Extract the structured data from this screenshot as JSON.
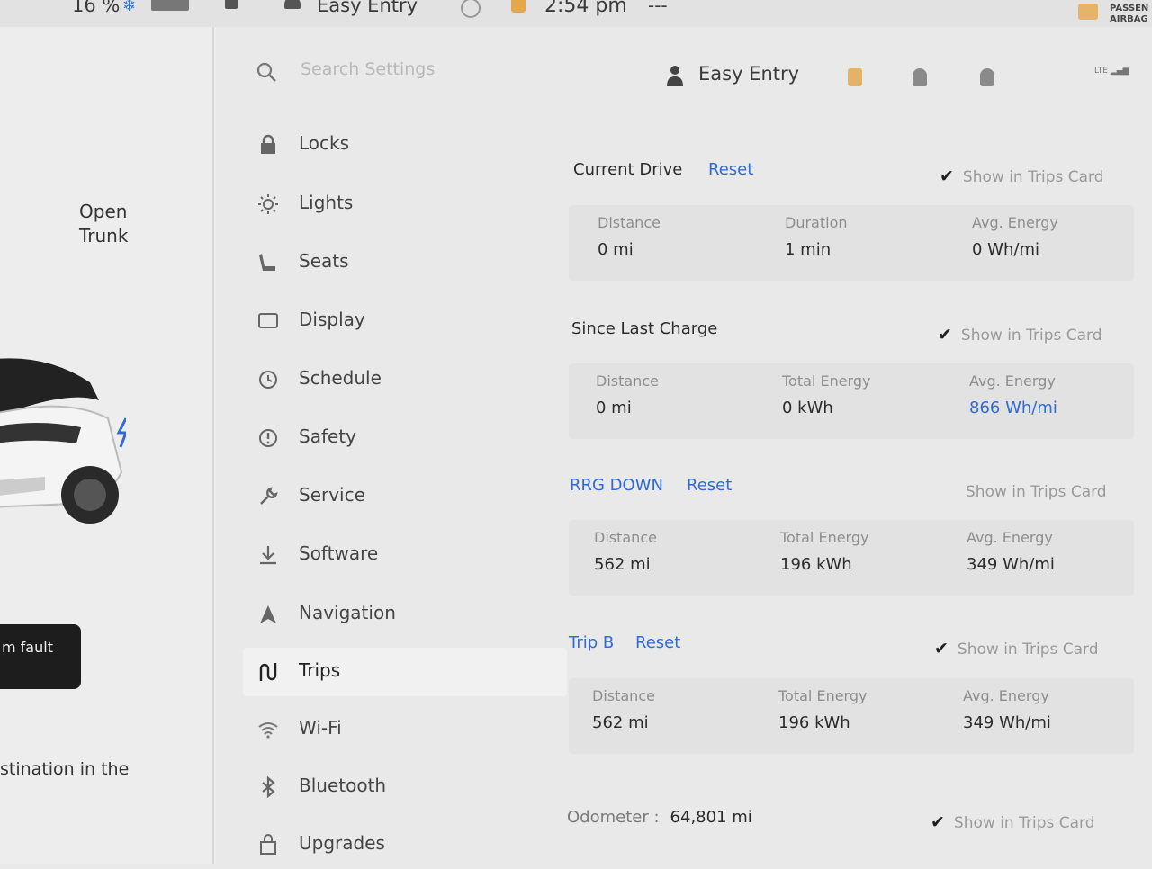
{
  "status_bar": {
    "battery": "16 %",
    "profile": "Easy Entry",
    "time": "2:54 pm",
    "temp": "---",
    "airbag_line1": "PASSEN",
    "airbag_line2": "AIRBAG"
  },
  "car_panel": {
    "open_trunk_line1": "Open",
    "open_trunk_line2": "Trunk",
    "fault_text": "m fault",
    "destination_text": "stination in the"
  },
  "search": {
    "placeholder": "Search Settings"
  },
  "sidebar": {
    "items": [
      {
        "label": "Locks",
        "icon": "lock-icon"
      },
      {
        "label": "Lights",
        "icon": "lightbulb-icon"
      },
      {
        "label": "Seats",
        "icon": "seat-icon"
      },
      {
        "label": "Display",
        "icon": "display-icon"
      },
      {
        "label": "Schedule",
        "icon": "clock-icon"
      },
      {
        "label": "Safety",
        "icon": "safety-icon"
      },
      {
        "label": "Service",
        "icon": "wrench-icon"
      },
      {
        "label": "Software",
        "icon": "download-icon"
      },
      {
        "label": "Navigation",
        "icon": "navigation-icon"
      },
      {
        "label": "Trips",
        "icon": "trips-icon",
        "active": true
      },
      {
        "label": "Wi-Fi",
        "icon": "wifi-icon"
      },
      {
        "label": "Bluetooth",
        "icon": "bluetooth-icon"
      },
      {
        "label": "Upgrades",
        "icon": "upgrades-icon"
      }
    ]
  },
  "header": {
    "profile": "Easy Entry",
    "lte": "LTE"
  },
  "trips": {
    "show_in_trips_card": "Show in Trips Card",
    "current_drive": {
      "title": "Current Drive",
      "reset": "Reset",
      "shown": true,
      "stats": [
        {
          "label": "Distance",
          "value": "0 mi"
        },
        {
          "label": "Duration",
          "value": "1 min"
        },
        {
          "label": "Avg. Energy",
          "value": "0 Wh/mi"
        }
      ]
    },
    "since_last_charge": {
      "title": "Since Last Charge",
      "shown": true,
      "stats": [
        {
          "label": "Distance",
          "value": "0 mi"
        },
        {
          "label": "Total Energy",
          "value": "0 kWh"
        },
        {
          "label": "Avg. Energy",
          "value": "866 Wh/mi"
        }
      ]
    },
    "trip_a": {
      "title": "RRG DOWN",
      "reset": "Reset",
      "shown": false,
      "stats": [
        {
          "label": "Distance",
          "value": "562 mi"
        },
        {
          "label": "Total Energy",
          "value": "196 kWh"
        },
        {
          "label": "Avg. Energy",
          "value": "349 Wh/mi"
        }
      ]
    },
    "trip_b": {
      "title": "Trip B",
      "reset": "Reset",
      "shown": true,
      "stats": [
        {
          "label": "Distance",
          "value": "562 mi"
        },
        {
          "label": "Total Energy",
          "value": "196 kWh"
        },
        {
          "label": "Avg. Energy",
          "value": "349 Wh/mi"
        }
      ]
    },
    "odometer": {
      "label": "Odometer :",
      "value": "64,801 mi",
      "shown": true
    }
  },
  "colors": {
    "accent_blue": "#2f6ad6",
    "background": "#e9e9e9",
    "stat_box": "#e2e2e2"
  }
}
